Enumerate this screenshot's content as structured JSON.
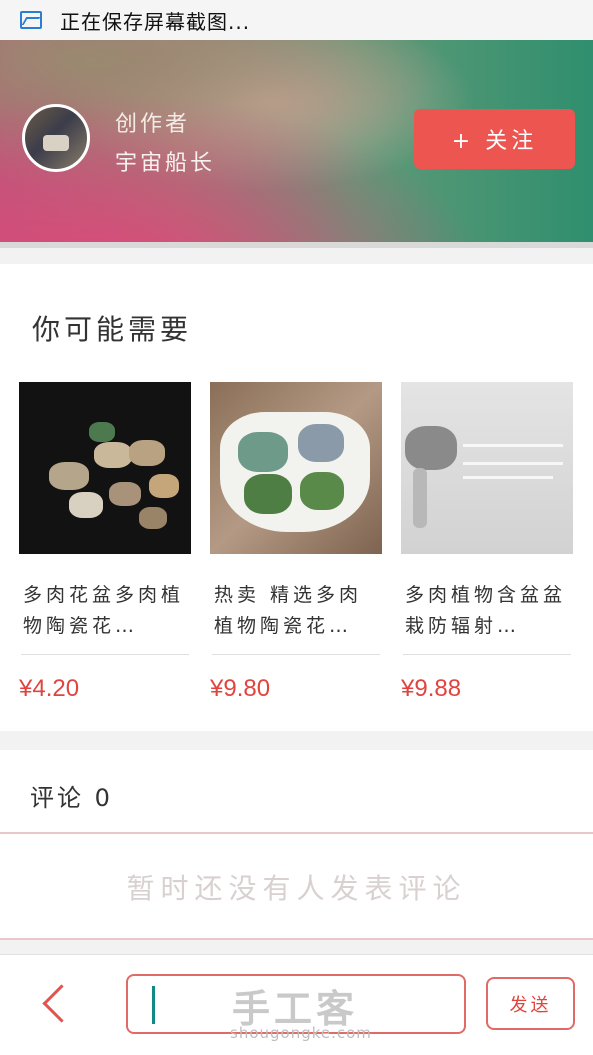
{
  "status_bar": {
    "text": "正在保存屏幕截图..."
  },
  "header": {
    "creator_label": "创作者",
    "creator_name": "宇宙船长",
    "follow_button": "+ 关注"
  },
  "recommend": {
    "title": "你可能需要",
    "products": [
      {
        "name": "多肉花盆多肉植物陶瓷花…",
        "price": "¥4.20",
        "image_text": ""
      },
      {
        "name": "热卖 精选多肉植物陶瓷花…",
        "price": "¥9.80",
        "image_text": ""
      },
      {
        "name": "多肉植物含盆盆栽防辐射…",
        "price": "¥9.88",
        "image_text": ""
      }
    ]
  },
  "comments": {
    "title": "评论 0",
    "empty_text": "暂时还没有人发表评论"
  },
  "bottom_bar": {
    "input_placeholder": "",
    "watermark": "手工客",
    "watermark_sub": "shougongke.com",
    "send_button": "发送"
  },
  "colors": {
    "accent": "#ec5550",
    "price": "#e0443e",
    "caret": "#118a86"
  }
}
